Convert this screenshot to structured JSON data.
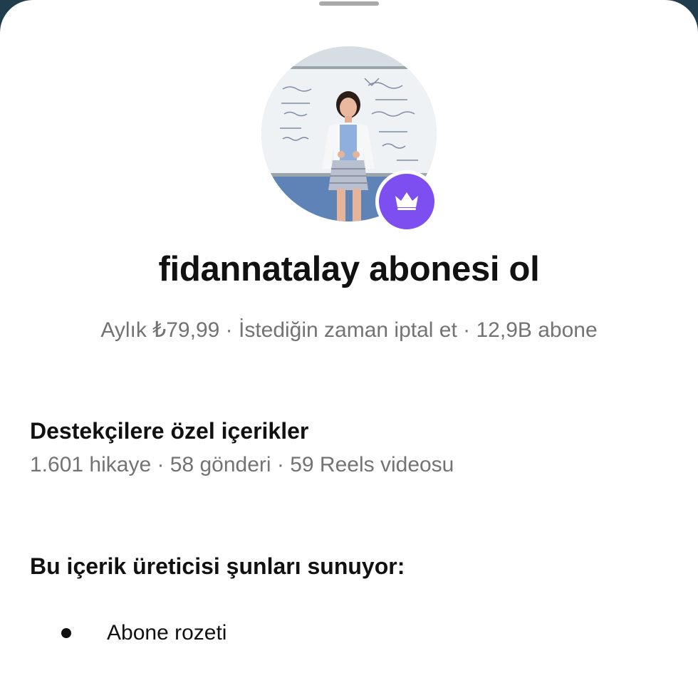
{
  "profile": {
    "title": "fidannatalay abonesi ol",
    "meta": "Aylık ₺79,99 · İstediğin zaman iptal et · 12,9B abone",
    "avatar_icon": "profile-photo",
    "badge_icon": "crown-icon",
    "badge_color": "#7d4ef0"
  },
  "exclusive": {
    "heading": "Destekçilere özel içerikler",
    "counts": "1.601 hikaye · 58 gönderi · 59 Reels videosu"
  },
  "offers": {
    "heading": "Bu içerik üreticisi şunları sunuyor:",
    "items": [
      {
        "label": "Abone rozeti"
      }
    ]
  }
}
